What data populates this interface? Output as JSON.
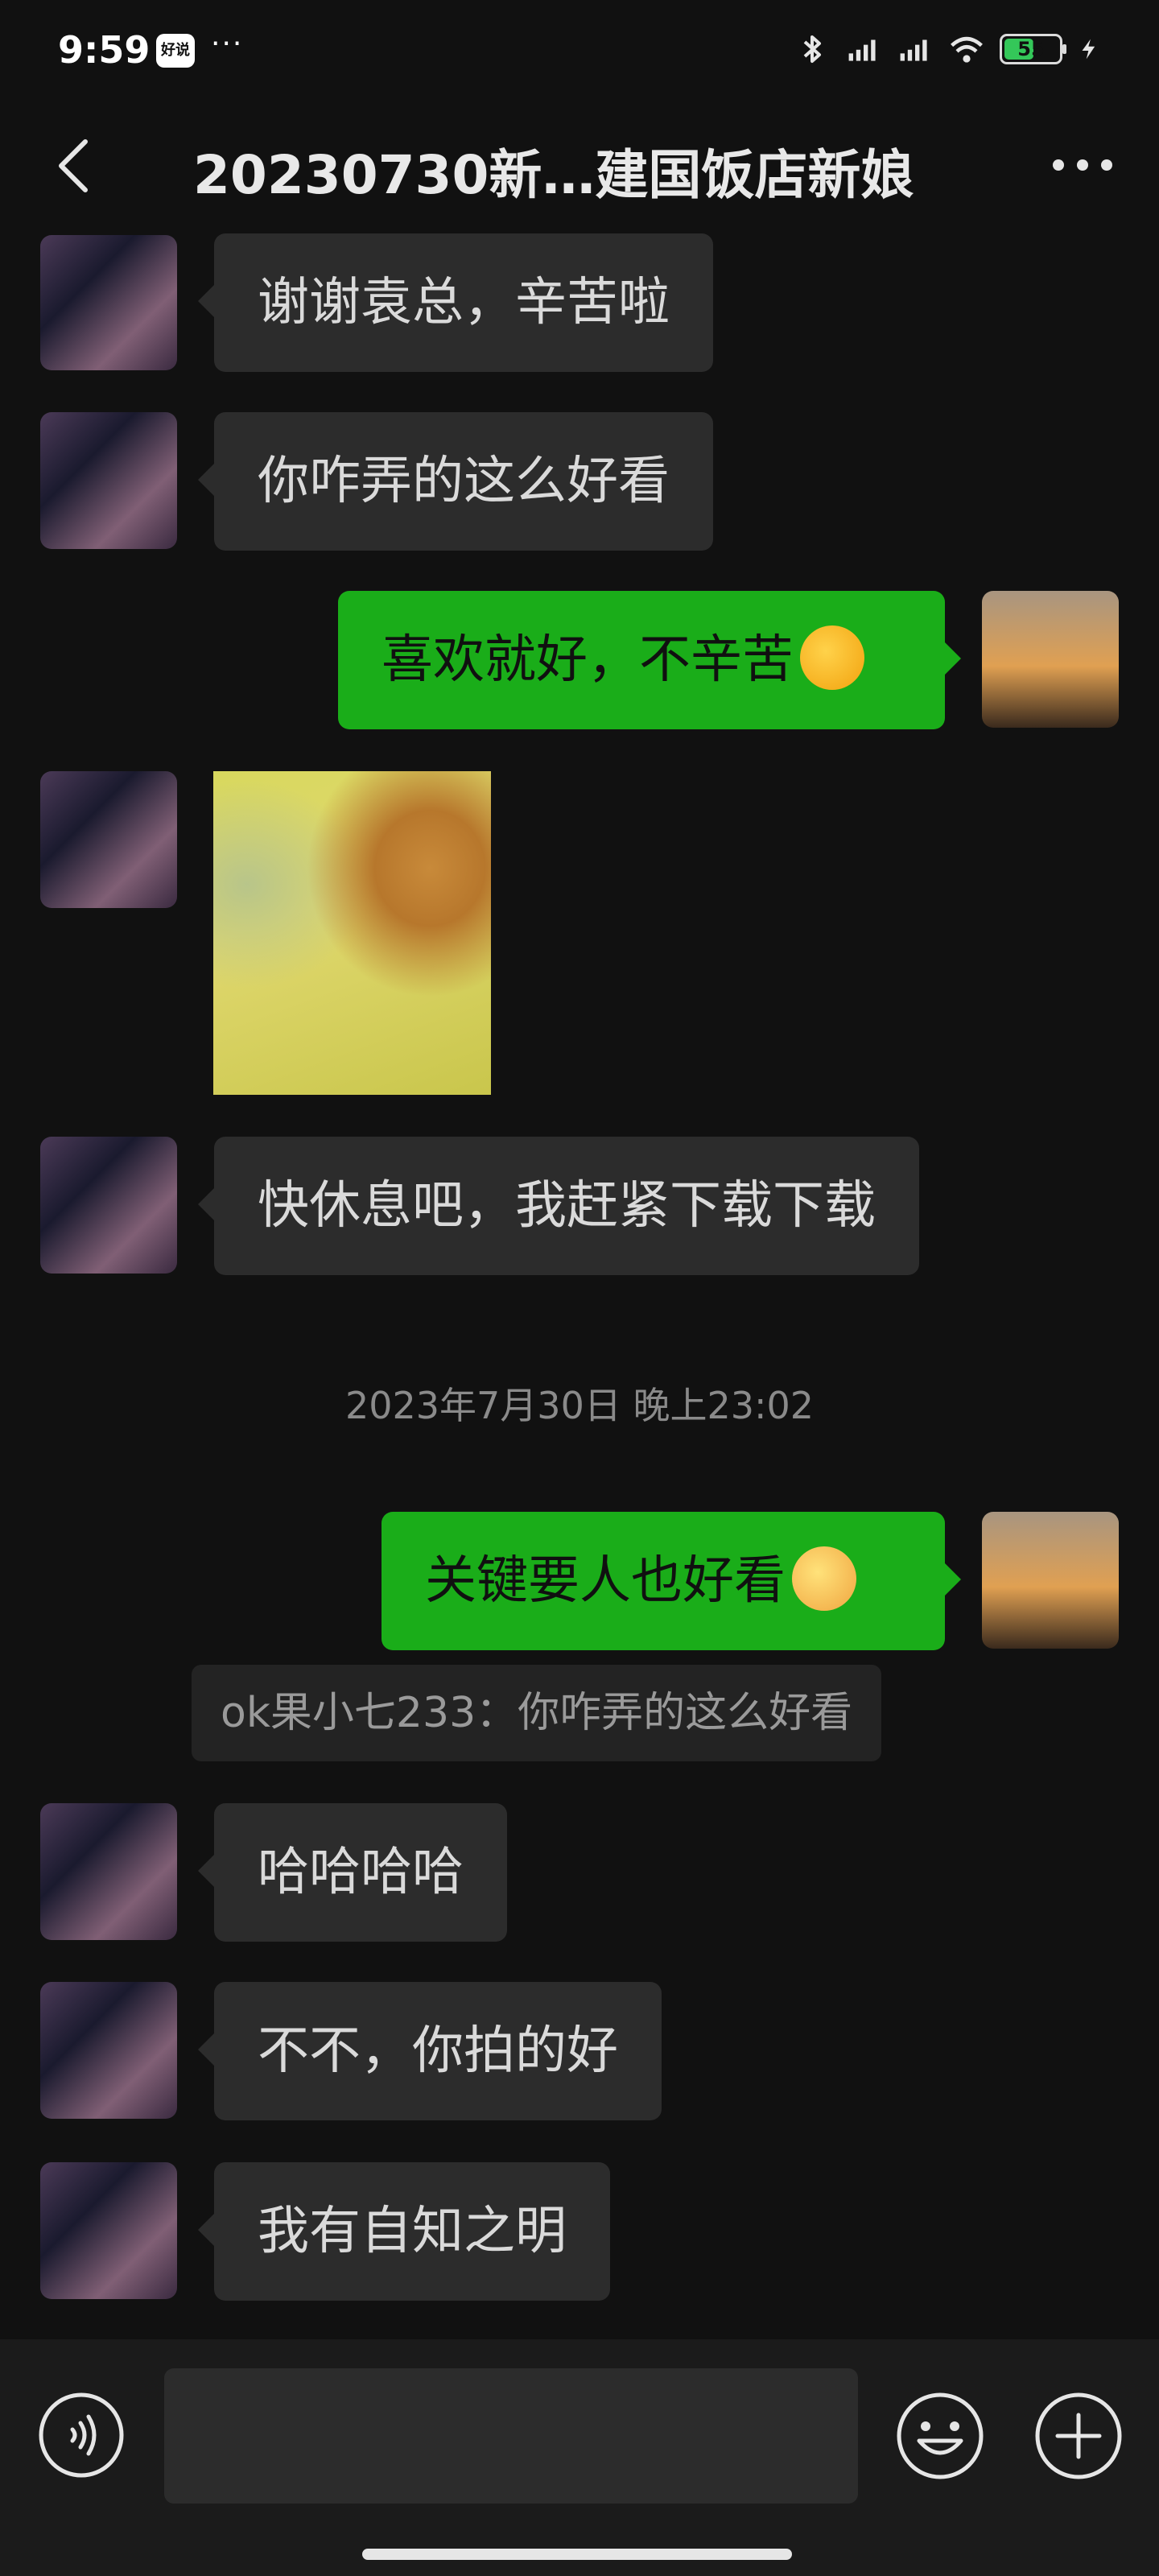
{
  "status_bar": {
    "time": "9:59",
    "app_badge": "好说",
    "more": "···",
    "battery": "55",
    "battery_level": 0.55
  },
  "header": {
    "title": "20230730新…建国饭店新娘",
    "back_icon": "chevron-left-icon",
    "more_icon": "more-horizontal-icon"
  },
  "messages": [
    {
      "side": "left",
      "text": "谢谢袁总，辛苦啦"
    },
    {
      "side": "left",
      "text": "你咋弄的这么好看"
    },
    {
      "side": "right",
      "text": "喜欢就好，不辛苦",
      "emoji": "thinking-face-emoji"
    },
    {
      "side": "left",
      "type": "image",
      "desc": "cats-photo"
    },
    {
      "side": "left",
      "text": "快休息吧，我赶紧下载下载"
    },
    {
      "side": "right",
      "text": "关键要人也好看",
      "emoji": "cat-face-emoji"
    },
    {
      "side": "left",
      "text": "哈哈哈哈"
    },
    {
      "side": "left",
      "text": "不不，你拍的好"
    },
    {
      "side": "left",
      "text": "我有自知之明"
    }
  ],
  "timestamp": "2023年7月30日 晚上23:02",
  "quote": "ok果小七233：你咋弄的这么好看",
  "input": {
    "value": "",
    "placeholder": ""
  },
  "colors": {
    "background": "#111111",
    "bubble_left": "#2c2c2c",
    "bubble_right": "#1aad19",
    "timestamp_text": "#8a8a8a"
  }
}
